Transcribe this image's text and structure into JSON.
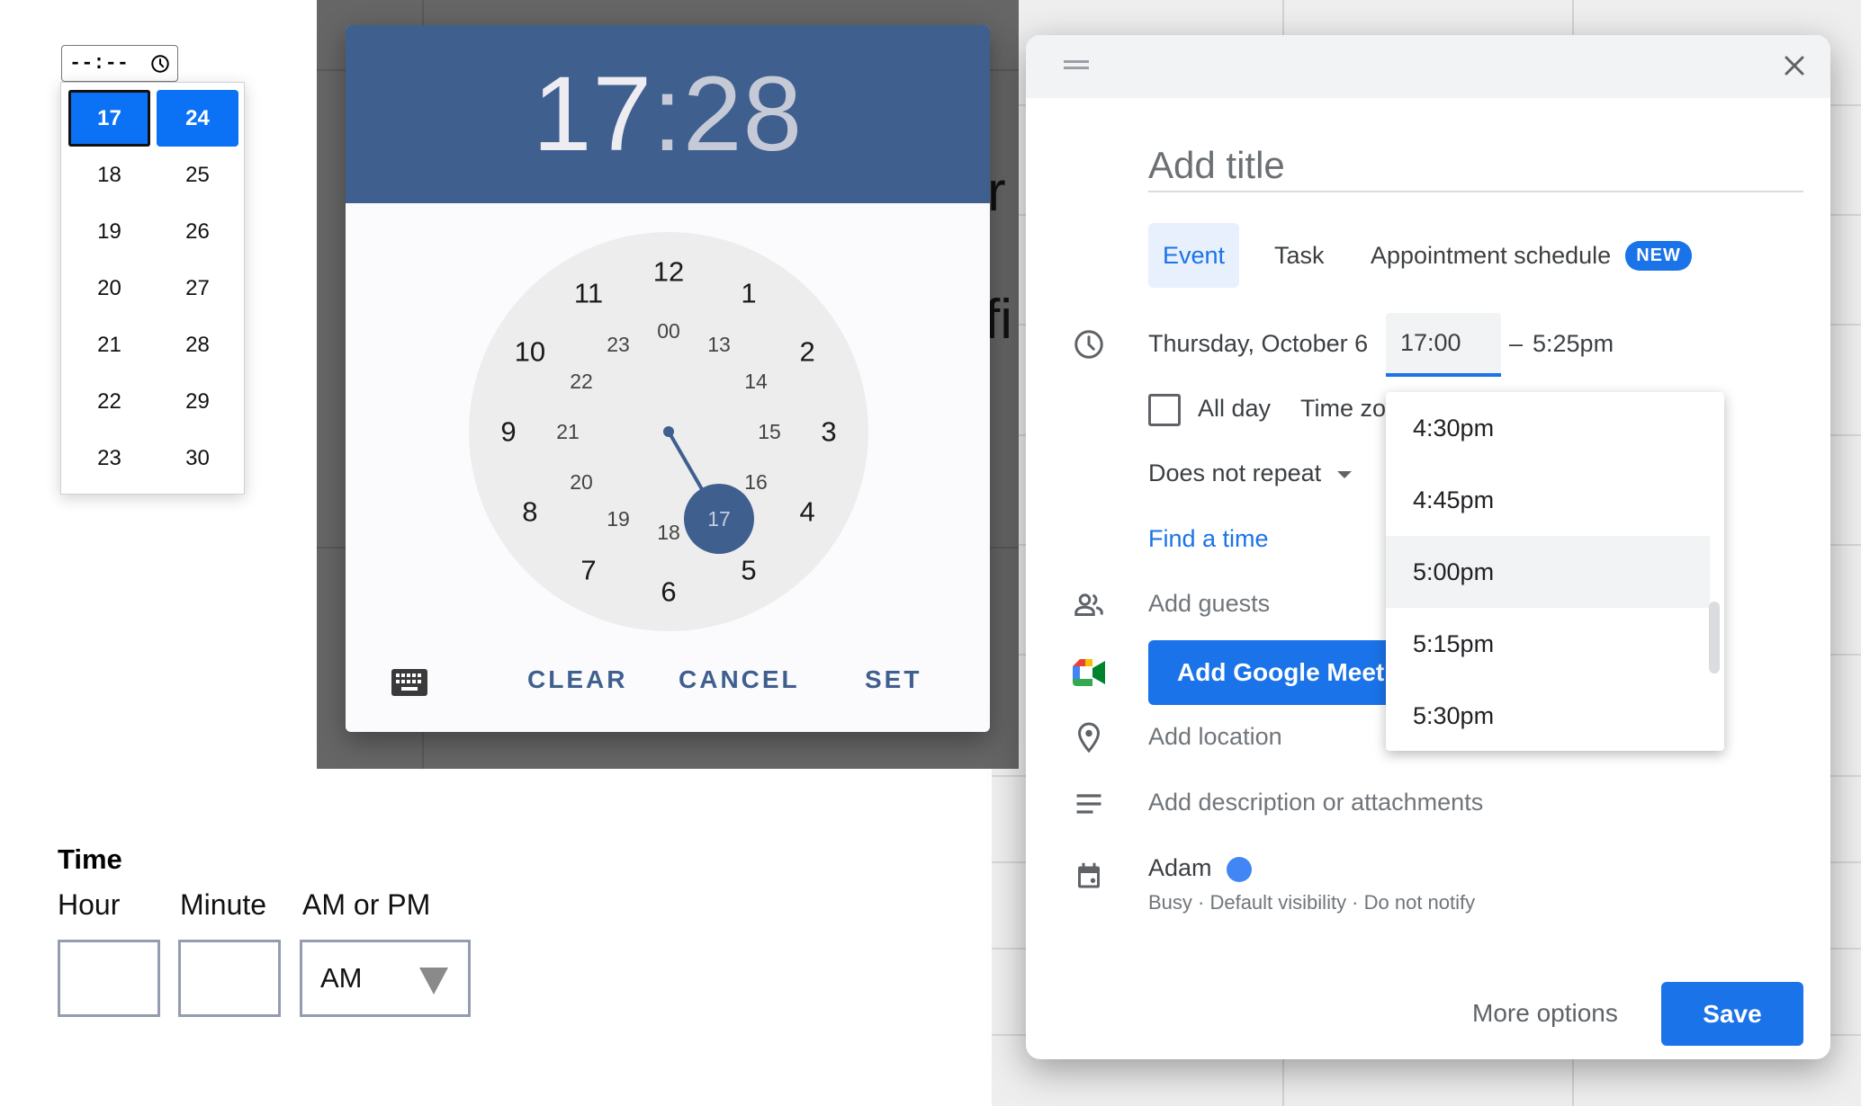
{
  "native_time_input": {
    "value": "--:--",
    "icon": "clock-icon"
  },
  "hour_picker": {
    "columns": [
      [
        "17",
        "18",
        "19",
        "20",
        "21",
        "22",
        "23"
      ],
      [
        "24",
        "25",
        "26",
        "27",
        "28",
        "29",
        "30"
      ]
    ],
    "selected": [
      "17",
      "24"
    ],
    "focused": "17",
    "accent_color": "#0b72f6"
  },
  "time_form": {
    "title": "Time",
    "hour_label": "Hour",
    "minute_label": "Minute",
    "ampm_label": "AM or PM",
    "hour_value": "",
    "minute_value": "",
    "ampm_value": "AM"
  },
  "background_fragments": {
    "text_1": "r",
    "text_2": "fi"
  },
  "clock_dialog": {
    "hour": "17",
    "separator": ":",
    "minute": "28",
    "header_color": "#3f5f8f",
    "outer_hours": [
      "12",
      "1",
      "2",
      "3",
      "4",
      "5",
      "6",
      "7",
      "8",
      "9",
      "10",
      "11"
    ],
    "inner_hours": [
      "00",
      "13",
      "14",
      "15",
      "16",
      "17",
      "18",
      "19",
      "20",
      "21",
      "22",
      "23"
    ],
    "selected_hour": "17",
    "buttons": {
      "keyboard_icon": "keyboard-icon",
      "clear": "CLEAR",
      "cancel": "CANCEL",
      "set": "SET"
    }
  },
  "event_dialog": {
    "drag_icon": "drag-handle-icon",
    "close_icon": "close-icon",
    "title_placeholder": "Add title",
    "tabs": [
      {
        "label": "Event",
        "active": true
      },
      {
        "label": "Task",
        "active": false
      },
      {
        "label": "Appointment schedule",
        "active": false,
        "badge": "NEW"
      }
    ],
    "date": "Thursday, October 6",
    "start_time": "17:00",
    "dash": "–",
    "end_time": "5:25pm",
    "all_day_label": "All day",
    "all_day_checked": false,
    "time_zone_label": "Time zone",
    "repeat_label": "Does not repeat",
    "find_time_label": "Find a time",
    "add_guests_label": "Add guests",
    "meet_button_label": "Add Google Meet video conferencing",
    "add_location_label": "Add location",
    "add_description_label": "Add description or attachments",
    "calendar_owner": "Adam",
    "calendar_color": "#4285f4",
    "calendar_details": "Busy · Default visibility · Do not notify",
    "more_options_label": "More options",
    "save_label": "Save",
    "accent_color": "#1a73e8",
    "time_options": [
      "4:30pm",
      "4:45pm",
      "5:00pm",
      "5:15pm",
      "5:30pm"
    ],
    "highlighted_option": "5:00pm"
  }
}
